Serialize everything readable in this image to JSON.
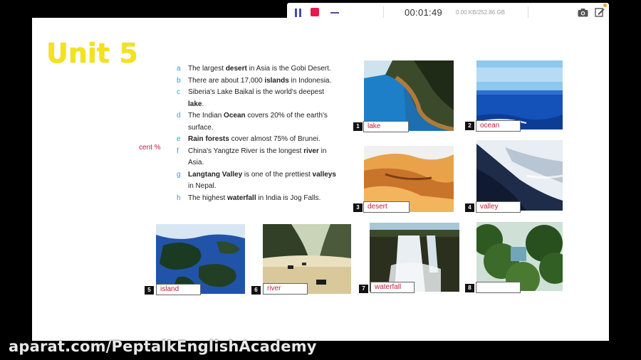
{
  "recorder": {
    "timer": "00:01:49",
    "storage": "0.00 KB/252.86 GB"
  },
  "slide": {
    "unit_title": "Unit 5",
    "side_fragment": "cent %",
    "sentences": [
      {
        "letter": "a",
        "parts": [
          [
            "The largest ",
            false
          ],
          [
            "desert",
            true
          ],
          [
            " in Asia is the Gobi Desert.",
            false
          ]
        ]
      },
      {
        "letter": "b",
        "parts": [
          [
            "There are about 17,000 ",
            false
          ],
          [
            "islands",
            true
          ],
          [
            " in Indonesia.",
            false
          ]
        ]
      },
      {
        "letter": "c",
        "parts": [
          [
            "Siberia's Lake Baikal is the world's deepest ",
            false
          ],
          [
            "lake",
            true
          ],
          [
            ".",
            false
          ]
        ]
      },
      {
        "letter": "d",
        "parts": [
          [
            "The Indian ",
            false
          ],
          [
            "Ocean",
            true
          ],
          [
            " covers 20% of the earth's surface.",
            false
          ]
        ]
      },
      {
        "letter": "e",
        "parts": [
          [
            "Rain forests",
            true
          ],
          [
            " cover almost 75% of Brunei.",
            false
          ]
        ]
      },
      {
        "letter": "f",
        "parts": [
          [
            "China's Yangtze River is the longest ",
            false
          ],
          [
            "river",
            true
          ],
          [
            " in Asia.",
            false
          ]
        ]
      },
      {
        "letter": "g",
        "parts": [
          [
            "Langtang Valley ",
            true
          ],
          [
            "is one of the prettiest ",
            false
          ],
          [
            "valleys",
            true
          ],
          [
            " in Nepal.",
            false
          ]
        ]
      },
      {
        "letter": "h",
        "parts": [
          [
            "The highest ",
            false
          ],
          [
            "waterfall",
            true
          ],
          [
            " in India is Jog Falls.",
            false
          ]
        ]
      }
    ],
    "pictures": [
      {
        "num": "1",
        "label": "lake"
      },
      {
        "num": "2",
        "label": "ocean"
      },
      {
        "num": "3",
        "label": "desert"
      },
      {
        "num": "4",
        "label": "valley"
      },
      {
        "num": "5",
        "label": "island"
      },
      {
        "num": "6",
        "label": "river"
      },
      {
        "num": "7",
        "label": "waterfall"
      },
      {
        "num": "8",
        "label": ""
      }
    ]
  },
  "watermark": "aparat.com/PeptalkEnglishAcademy",
  "icons": [
    "pause-icon",
    "stop-icon",
    "minimize-icon",
    "camera-icon",
    "edit-icon"
  ]
}
